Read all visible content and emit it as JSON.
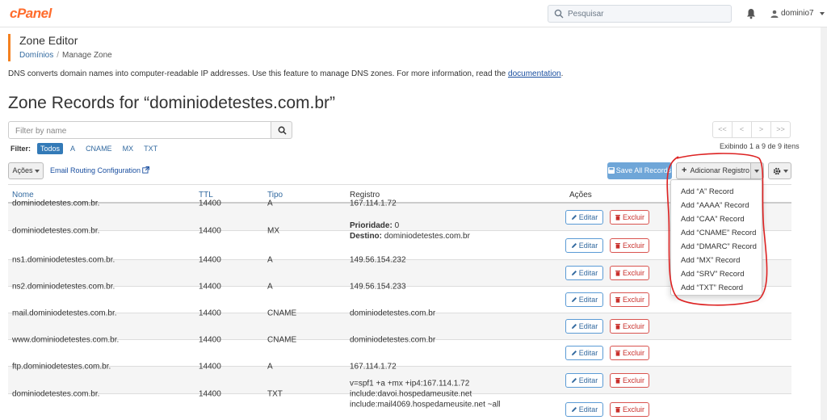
{
  "topbar": {
    "logo": "cPanel",
    "search_placeholder": "Pesquisar",
    "username": "dominio7"
  },
  "header": {
    "title": "Zone Editor",
    "breadcrumb": [
      "Domínios",
      "Manage Zone"
    ]
  },
  "description": {
    "text": "DNS converts domain names into computer-readable IP addresses. Use this feature to manage DNS zones. For more information, read the ",
    "link": "documentation",
    "end": "."
  },
  "zone_title": "Zone Records for “dominiodetestes.com.br”",
  "filter": {
    "placeholder": "Filter by name",
    "label": "Filter:",
    "options": [
      "Todos",
      "A",
      "CNAME",
      "MX",
      "TXT"
    ],
    "active": "Todos"
  },
  "pager": {
    "buttons": [
      "<<",
      "<",
      ">",
      ">>"
    ],
    "showing": "Exibindo 1 a 9 de 9 itens"
  },
  "toolbar": {
    "acoes": "Ações",
    "email_routing": "Email Routing Configuration",
    "save_all": "Save All Records",
    "add_record": "Adicionar Registro"
  },
  "table": {
    "headers": [
      "Nome",
      "TTL",
      "Tipo",
      "Registro",
      "Ações"
    ],
    "edit_label": "Editar",
    "delete_label": "Excluir",
    "priority_label": "Prioridade:",
    "destination_label": "Destino:",
    "rows": [
      {
        "name": "dominiodetestes.com.br.",
        "ttl": "14400",
        "type": "A",
        "record": "167.114.1.72"
      },
      {
        "name": "dominiodetestes.com.br.",
        "ttl": "14400",
        "type": "MX",
        "priority": "0",
        "destination": "dominiodetestes.com.br"
      },
      {
        "name": "ns1.dominiodetestes.com.br.",
        "ttl": "14400",
        "type": "A",
        "record": "149.56.154.232"
      },
      {
        "name": "ns2.dominiodetestes.com.br.",
        "ttl": "14400",
        "type": "A",
        "record": "149.56.154.233"
      },
      {
        "name": "mail.dominiodetestes.com.br.",
        "ttl": "14400",
        "type": "CNAME",
        "record": "dominiodetestes.com.br"
      },
      {
        "name": "www.dominiodetestes.com.br.",
        "ttl": "14400",
        "type": "CNAME",
        "record": "dominiodetestes.com.br"
      },
      {
        "name": "ftp.dominiodetestes.com.br.",
        "ttl": "14400",
        "type": "A",
        "record": "167.114.1.72"
      },
      {
        "name": "dominiodetestes.com.br.",
        "ttl": "14400",
        "type": "TXT",
        "record": "v=spf1 +a +mx +ip4:167.114.1.72 include:davoi.hospedameusite.net include:mail4069.hospedameusite.net ~all"
      }
    ]
  },
  "dropdown": {
    "items": [
      "Add “A” Record",
      "Add “AAAA” Record",
      "Add “CAA” Record",
      "Add “CNAME” Record",
      "Add “DMARC” Record",
      "Add “MX” Record",
      "Add “SRV” Record",
      "Add “TXT” Record"
    ]
  },
  "colors": {
    "brand": "#ff6c2c",
    "accent": "#f48120",
    "link": "#336aa0",
    "primary": "#337ab7",
    "danger": "#d9534f",
    "annotation": "#d22"
  }
}
